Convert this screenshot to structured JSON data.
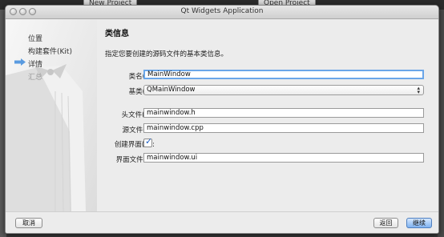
{
  "background": {
    "new_project_label": "New Project",
    "open_project_label": "Open Project"
  },
  "window": {
    "title": "Qt Widgets Application"
  },
  "sidebar": {
    "items": [
      {
        "label": "位置",
        "state": "done"
      },
      {
        "label": "构建套件(Kit)",
        "state": "done"
      },
      {
        "label": "详情",
        "state": "current"
      },
      {
        "label": "汇总",
        "state": "pending"
      }
    ]
  },
  "page": {
    "title": "类信息",
    "description": "指定您要创建的源码文件的基本类信息。"
  },
  "form": {
    "class_name": {
      "label": "类名(C):",
      "value": "MainWindow"
    },
    "base_class": {
      "label": "基类(B):",
      "value": "QMainWindow"
    },
    "header_file": {
      "label": "头文件(H):",
      "value": "mainwindow.h"
    },
    "source_file": {
      "label": "源文件(S):",
      "value": "mainwindow.cpp"
    },
    "create_form": {
      "label": "创建界面(G):",
      "checked": true
    },
    "form_file": {
      "label": "界面文件(F):",
      "value": "mainwindow.ui"
    }
  },
  "footer": {
    "cancel_label": "取消",
    "back_label": "返回",
    "continue_label": "继续"
  },
  "colors": {
    "accent": "#6aa6e8",
    "primary_button": "#7fb2f0"
  }
}
